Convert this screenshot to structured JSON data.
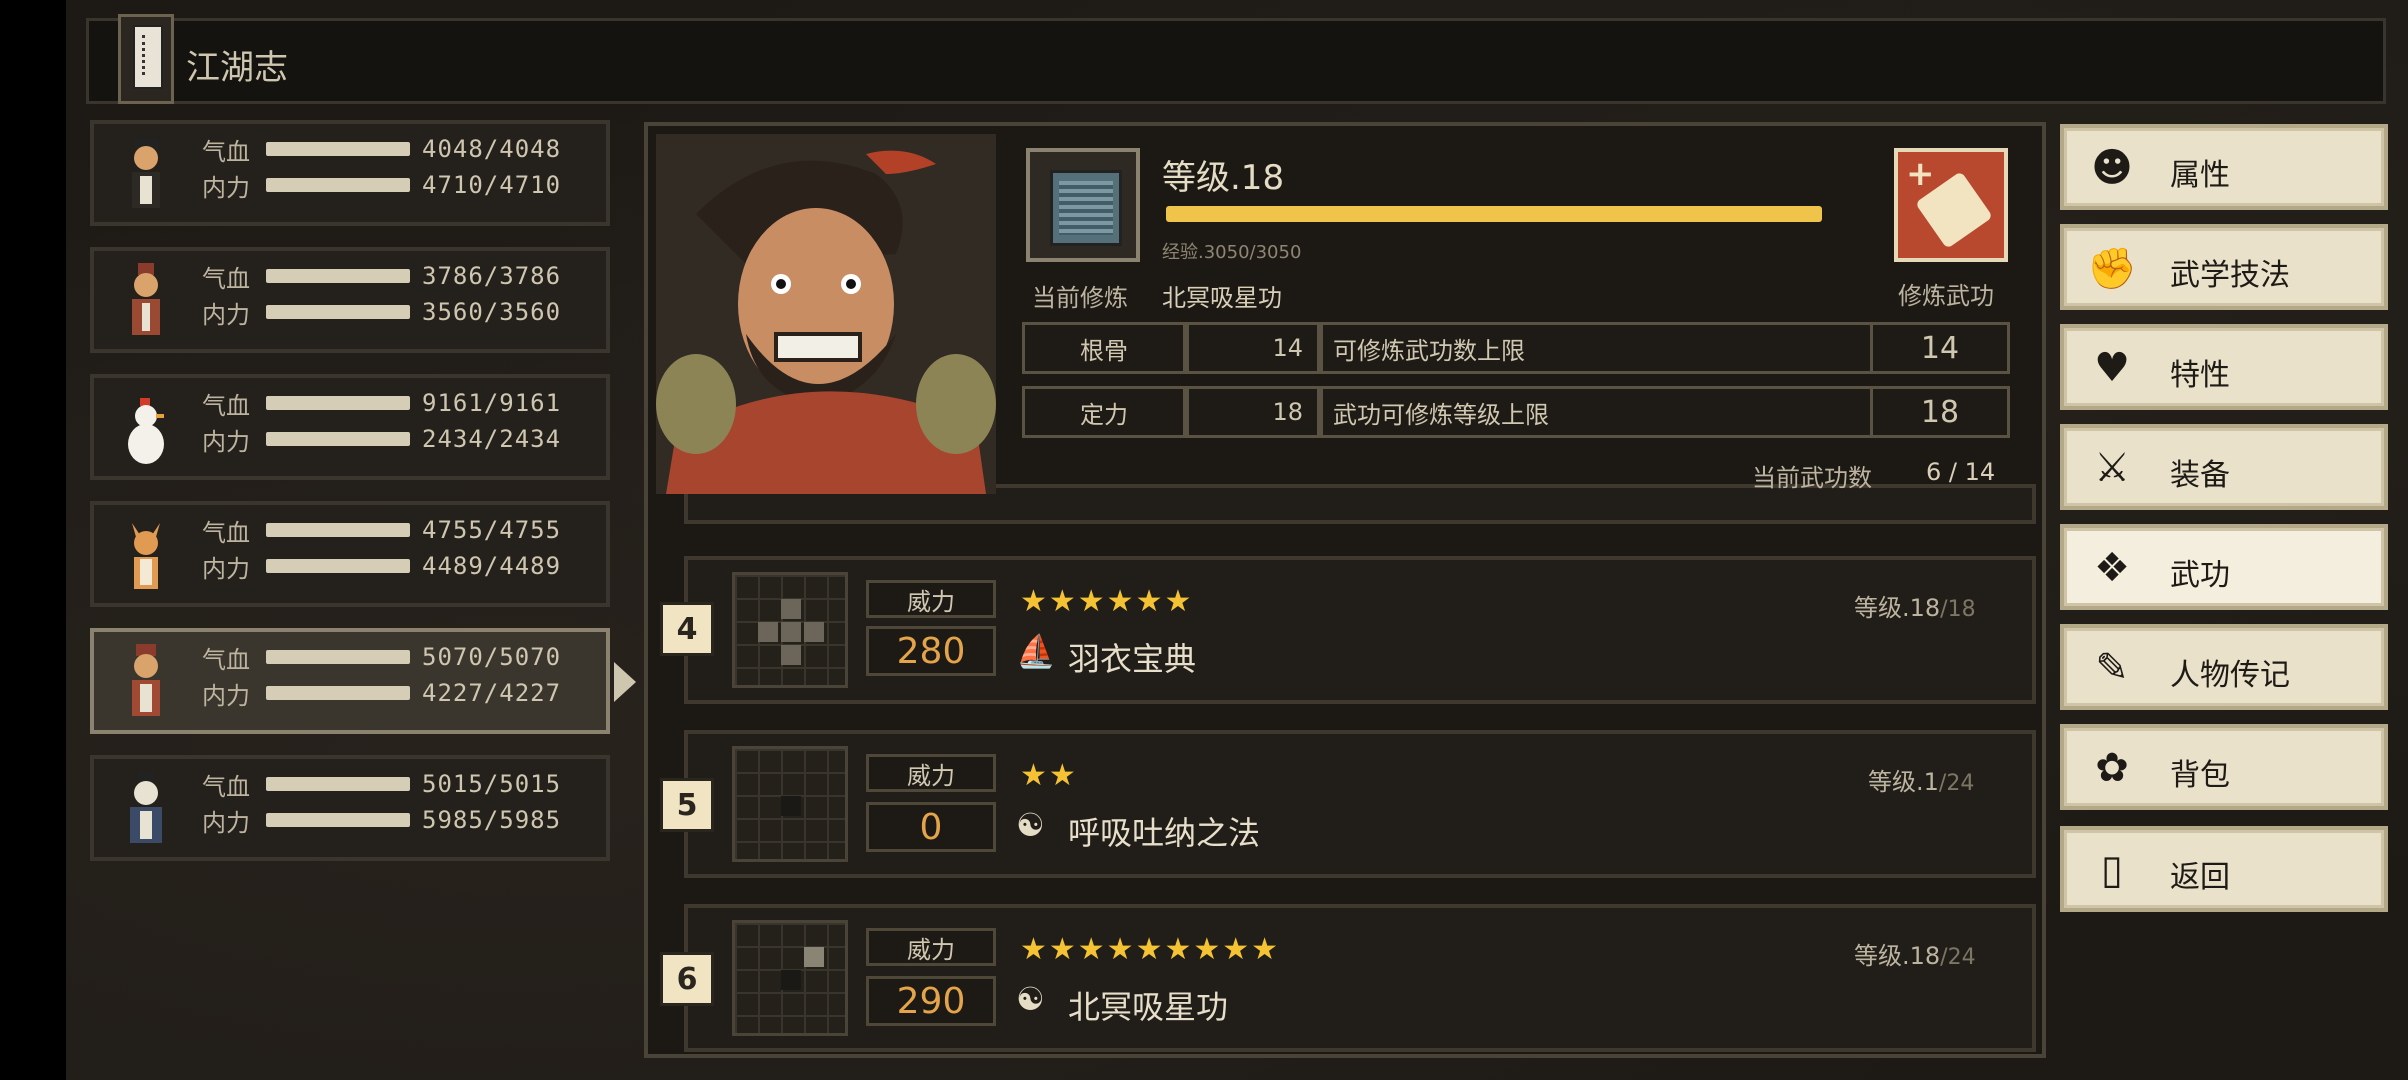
{
  "window": {
    "title": "江湖志"
  },
  "labels": {
    "qixue": "气血",
    "neili": "内力"
  },
  "characters": [
    {
      "qixue": "4048/4048",
      "neili": "4710/4710",
      "icon": "warrior-avatar-icon"
    },
    {
      "qixue": "3786/3786",
      "neili": "3560/3560",
      "icon": "monk-avatar-icon"
    },
    {
      "qixue": "9161/9161",
      "neili": "2434/2434",
      "icon": "chicken-avatar-icon"
    },
    {
      "qixue": "4755/4755",
      "neili": "4489/4489",
      "icon": "fox-avatar-icon"
    },
    {
      "qixue": "5070/5070",
      "neili": "4227/4227",
      "icon": "warrior-avatar-icon",
      "selected": true
    },
    {
      "qixue": "5015/5015",
      "neili": "5985/5985",
      "icon": "masked-avatar-icon"
    }
  ],
  "profile": {
    "level_text": "等级.18",
    "exp_text": "经验.3050/3050",
    "exp_fraction": 1.0,
    "current_label": "当前修炼",
    "current_name": "北冥吸星功",
    "practice_label": "修炼武功",
    "attributes": [
      {
        "name": "根骨",
        "value": "14",
        "desc": "可修炼武功数上限",
        "cap": "14"
      },
      {
        "name": "定力",
        "value": "18",
        "desc": "武功可修炼等级上限",
        "cap": "18"
      }
    ],
    "count_label": "当前武功数",
    "count_value": "6 / 14"
  },
  "skills": [
    {
      "index": "4",
      "power_label": "威力",
      "power": "280",
      "stars": "★★★★★★",
      "star_count": 6,
      "icon": "feather-icon",
      "name": "羽衣宝典",
      "level": "等级.18",
      "level_max": "/18"
    },
    {
      "index": "5",
      "power_label": "威力",
      "power": "0",
      "stars": "★★",
      "star_count": 2,
      "icon": "yin-yang-icon",
      "name": "呼吸吐纳之法",
      "level": "等级.1",
      "level_max": "/24"
    },
    {
      "index": "6",
      "power_label": "威力",
      "power": "290",
      "stars": "★★★★★★★★★",
      "star_count": 9,
      "icon": "yin-yang-icon",
      "name": "北冥吸星功",
      "level": "等级.18",
      "level_max": "/24"
    }
  ],
  "menu": [
    {
      "label": "属性",
      "icon": "person-icon",
      "glyph": "☻"
    },
    {
      "label": "武学技法",
      "icon": "fist-icon",
      "glyph": "✊"
    },
    {
      "label": "特性",
      "icon": "heart-person-icon",
      "glyph": "♥"
    },
    {
      "label": "装备",
      "icon": "sword-icon",
      "glyph": "⚔"
    },
    {
      "label": "武功",
      "icon": "scroll-book-icon",
      "glyph": "❖",
      "active": true
    },
    {
      "label": "人物传记",
      "icon": "book-icon",
      "glyph": "✎"
    },
    {
      "label": "背包",
      "icon": "bag-icon",
      "glyph": "✿"
    },
    {
      "label": "返回",
      "icon": "door-icon",
      "glyph": "▯"
    }
  ],
  "colors": {
    "exp_bar": "#f0c44a",
    "power": "#e4a54a",
    "star": "#f4c233",
    "practice_btn": "#b8482e"
  }
}
